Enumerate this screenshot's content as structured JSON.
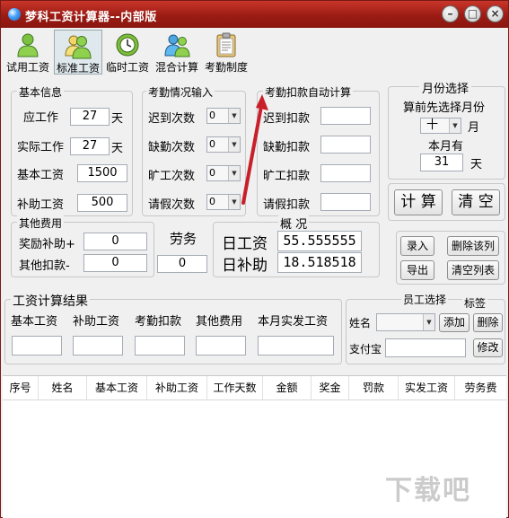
{
  "window": {
    "title": "梦科工资计算器--内部版"
  },
  "toolbar": {
    "items": [
      {
        "label": "试用工资",
        "icon": "user-icon"
      },
      {
        "label": "标准工资",
        "icon": "users-icon"
      },
      {
        "label": "临时工资",
        "icon": "clock-icon"
      },
      {
        "label": "混合计算",
        "icon": "user-group-icon"
      },
      {
        "label": "考勤制度",
        "icon": "clipboard-icon"
      }
    ]
  },
  "basic_info": {
    "title": "基本信息",
    "work_days_label": "应工作",
    "work_days": "27",
    "work_days_unit": "天",
    "actual_days_label": "实际工作",
    "actual_days": "27",
    "actual_days_unit": "天",
    "base_salary_label": "基本工资",
    "base_salary": "1500",
    "subsidy_label": "补助工资",
    "subsidy": "500"
  },
  "attendance_input": {
    "title": "考勤情况输入",
    "rows": [
      {
        "label": "迟到次数",
        "value": "0"
      },
      {
        "label": "缺勤次数",
        "value": "0"
      },
      {
        "label": "旷工次数",
        "value": "0"
      },
      {
        "label": "请假次数",
        "value": "0"
      }
    ]
  },
  "attendance_deduct": {
    "title": "考勤扣款自动计算",
    "rows": [
      {
        "label": "迟到扣款",
        "value": ""
      },
      {
        "label": "缺勤扣款",
        "value": ""
      },
      {
        "label": "旷工扣款",
        "value": ""
      },
      {
        "label": "请假扣款",
        "value": ""
      }
    ]
  },
  "month_select": {
    "title": "月份选择",
    "hint": "算前先选择月份",
    "month_value": "十",
    "month_unit": "月",
    "days_label": "本月有",
    "days_value": "31",
    "days_unit": "天"
  },
  "actions": {
    "calculate": "计 算",
    "clear": "清 空"
  },
  "other_fees": {
    "title": "其他费用",
    "bonus_label": "奖励补助+",
    "bonus": "0",
    "deduct_label": "其他扣款-",
    "deduct": "0"
  },
  "labor": {
    "label": "劳务",
    "value": "0"
  },
  "overview": {
    "title": "概 况",
    "daily_wage_label": "日工资",
    "daily_wage": "55.555555",
    "daily_subsidy_label": "日补助",
    "daily_subsidy": "18.518518"
  },
  "list_actions": {
    "enter": "录入",
    "delete_row": "删除该列",
    "export": "导出",
    "clear_list": "清空列表"
  },
  "results": {
    "title": "工资计算结果",
    "columns": [
      "基本工资",
      "补助工资",
      "考勤扣款",
      "其他费用",
      "本月实发工资"
    ]
  },
  "employee": {
    "title": "员工选择",
    "tag_label": "标签",
    "name_label": "姓名",
    "add": "添加",
    "delete": "删除",
    "alipay_label": "支付宝",
    "modify": "修改"
  },
  "table": {
    "headers": [
      "序号",
      "姓名",
      "基本工资",
      "补助工资",
      "工作天数",
      "金额",
      "奖金",
      "罚款",
      "实发工资",
      "劳务费"
    ]
  },
  "colors": {
    "titlebar": "#9b1c14",
    "arrow": "#c8202a"
  }
}
